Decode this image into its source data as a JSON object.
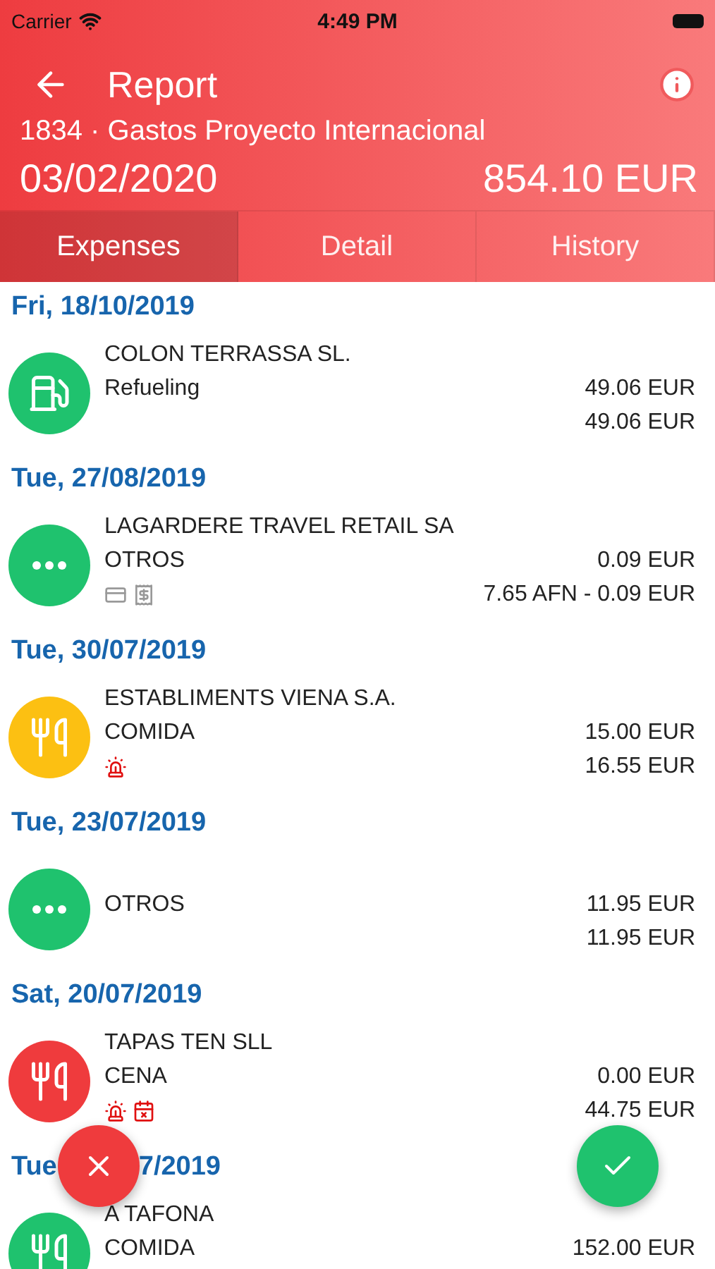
{
  "status_bar": {
    "carrier": "Carrier",
    "time": "4:49 PM"
  },
  "header": {
    "title": "Report",
    "subtitle": "1834 · Gastos Proyecto Internacional",
    "date": "03/02/2020",
    "total": "854.10 EUR"
  },
  "tabs": [
    {
      "label": "Expenses",
      "selected": true
    },
    {
      "label": "Detail",
      "selected": false
    },
    {
      "label": "History",
      "selected": false
    }
  ],
  "groups": [
    {
      "date_parts": [
        "Fri, 18/10/2019"
      ],
      "items": [
        {
          "kind": "fuel",
          "color": "#1fc26e",
          "merchant": "COLON TERRASSA SL.",
          "category": "Refueling",
          "amount": "49.06 EUR",
          "amount_2": "49.06 EUR"
        }
      ]
    },
    {
      "date_parts": [
        "Tue, 27/08/2019"
      ],
      "items": [
        {
          "kind": "other",
          "color": "#1fc26e",
          "merchant": "LAGARDERE TRAVEL RETAIL SA",
          "category": "OTROS",
          "amount": "0.09 EUR",
          "amount_2": "7.65 AFN - 0.09 EUR",
          "marks": [
            {
              "kind": "card"
            },
            {
              "kind": "receipt"
            }
          ]
        }
      ]
    },
    {
      "date_parts": [
        "Tue, 30/07/2019"
      ],
      "items": [
        {
          "kind": "food",
          "color": "#fcc012",
          "merchant": "ESTABLIMENTS VIENA S.A.",
          "category": "COMIDA",
          "amount": "15.00 EUR",
          "amount_2": "16.55 EUR",
          "marks": [
            {
              "kind": "alert"
            }
          ]
        }
      ]
    },
    {
      "date_parts": [
        "Tue, 23/07/2019"
      ],
      "items": [
        {
          "kind": "other",
          "color": "#1fc26e",
          "category": "OTROS",
          "amount": "11.95 EUR",
          "amount_2": "11.95 EUR"
        }
      ]
    },
    {
      "date_parts": [
        "Sat, 20/07/2019"
      ],
      "items": [
        {
          "kind": "food",
          "color": "#ef3b3d",
          "merchant": "TAPAS TEN SLL",
          "category": "CENA",
          "amount": "0.00 EUR",
          "amount_2": "44.75 EUR",
          "marks": [
            {
              "kind": "alert"
            },
            {
              "kind": "calendar"
            }
          ]
        }
      ]
    },
    {
      "date_parts": [
        "Tue",
        "7/2019"
      ],
      "items": [
        {
          "kind": "food",
          "color": "#1fc26e",
          "merchant": "A TAFONA",
          "category": "COMIDA",
          "amount": "152.00 EUR"
        }
      ]
    }
  ],
  "fabs": [
    {
      "kind": "reject"
    },
    {
      "kind": "approve"
    }
  ]
}
